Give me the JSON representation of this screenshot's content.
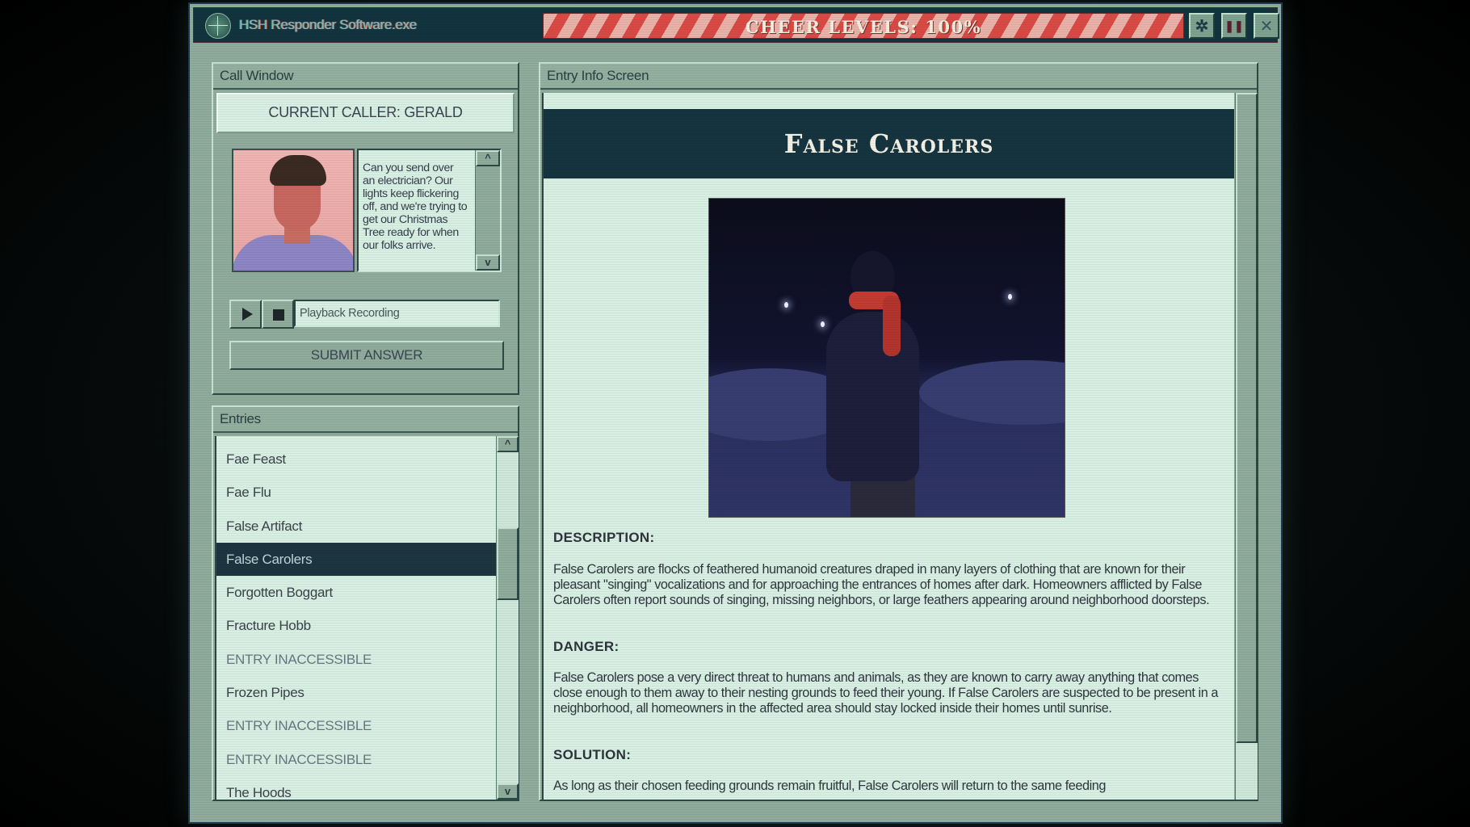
{
  "titlebar": {
    "app_title": "HSH Responder Software.exe",
    "cheer_label": "CHEER LEVELS: 100%",
    "cheer_level_percent": 100,
    "buttons": {
      "settings": "✲",
      "pause": "❚❚",
      "close": "✕"
    }
  },
  "call_window": {
    "header": "Call Window",
    "current_caller": "CURRENT CALLER: GERALD",
    "caller_message": "Can you send over an electrician? Our lights keep flickering off, and we're trying to get our Christmas Tree ready for when our folks arrive.",
    "scroll_up": "^",
    "scroll_down": "v",
    "playback_label": "Playback Recording",
    "submit_label": "SUBMIT ANSWER"
  },
  "entries": {
    "header": "Entries",
    "scroll_up": "^",
    "scroll_down": "v",
    "items": [
      {
        "label": "Fae Feast",
        "locked": false,
        "selected": false
      },
      {
        "label": "Fae Flu",
        "locked": false,
        "selected": false
      },
      {
        "label": "False Artifact",
        "locked": false,
        "selected": false
      },
      {
        "label": "False Carolers",
        "locked": false,
        "selected": true
      },
      {
        "label": "Forgotten Boggart",
        "locked": false,
        "selected": false
      },
      {
        "label": "Fracture Hobb",
        "locked": false,
        "selected": false
      },
      {
        "label": "ENTRY INACCESSIBLE",
        "locked": true,
        "selected": false
      },
      {
        "label": "Frozen Pipes",
        "locked": false,
        "selected": false
      },
      {
        "label": "ENTRY INACCESSIBLE",
        "locked": true,
        "selected": false
      },
      {
        "label": "ENTRY INACCESSIBLE",
        "locked": true,
        "selected": false
      },
      {
        "label": "The Hoods",
        "locked": false,
        "selected": false
      }
    ]
  },
  "entry_info": {
    "header": "Entry Info Screen",
    "title": "False Carolers",
    "description_heading": "DESCRIPTION:",
    "description": "False Carolers are flocks of feathered humanoid creatures draped in many layers of clothing that are known for their pleasant \"singing\" vocalizations and for approaching the entrances of homes after dark. Homeowners afflicted by False Carolers often report sounds of singing, missing neighbors, or large feathers appearing around neighborhood doorsteps.",
    "danger_heading": "DANGER:",
    "danger": "False Carolers pose a very direct threat to humans and animals, as they are known to carry away anything that comes close enough to them away to their nesting grounds to feed their young. If False Carolers are suspected to be present in a neighborhood, all homeowners in the affected area should stay locked inside their homes until sunrise.",
    "solution_heading": "SOLUTION:",
    "solution": "As long as their chosen feeding grounds remain fruitful, False Carolers will return to the same feeding"
  },
  "colors": {
    "window_bg": "#8fab9b",
    "titlebar_bg": "#12343e",
    "content_bg": "#d8efe4",
    "selected_bg": "#1c3540",
    "cheer_red": "#d94a44",
    "cheer_light": "#e9b2a8"
  }
}
